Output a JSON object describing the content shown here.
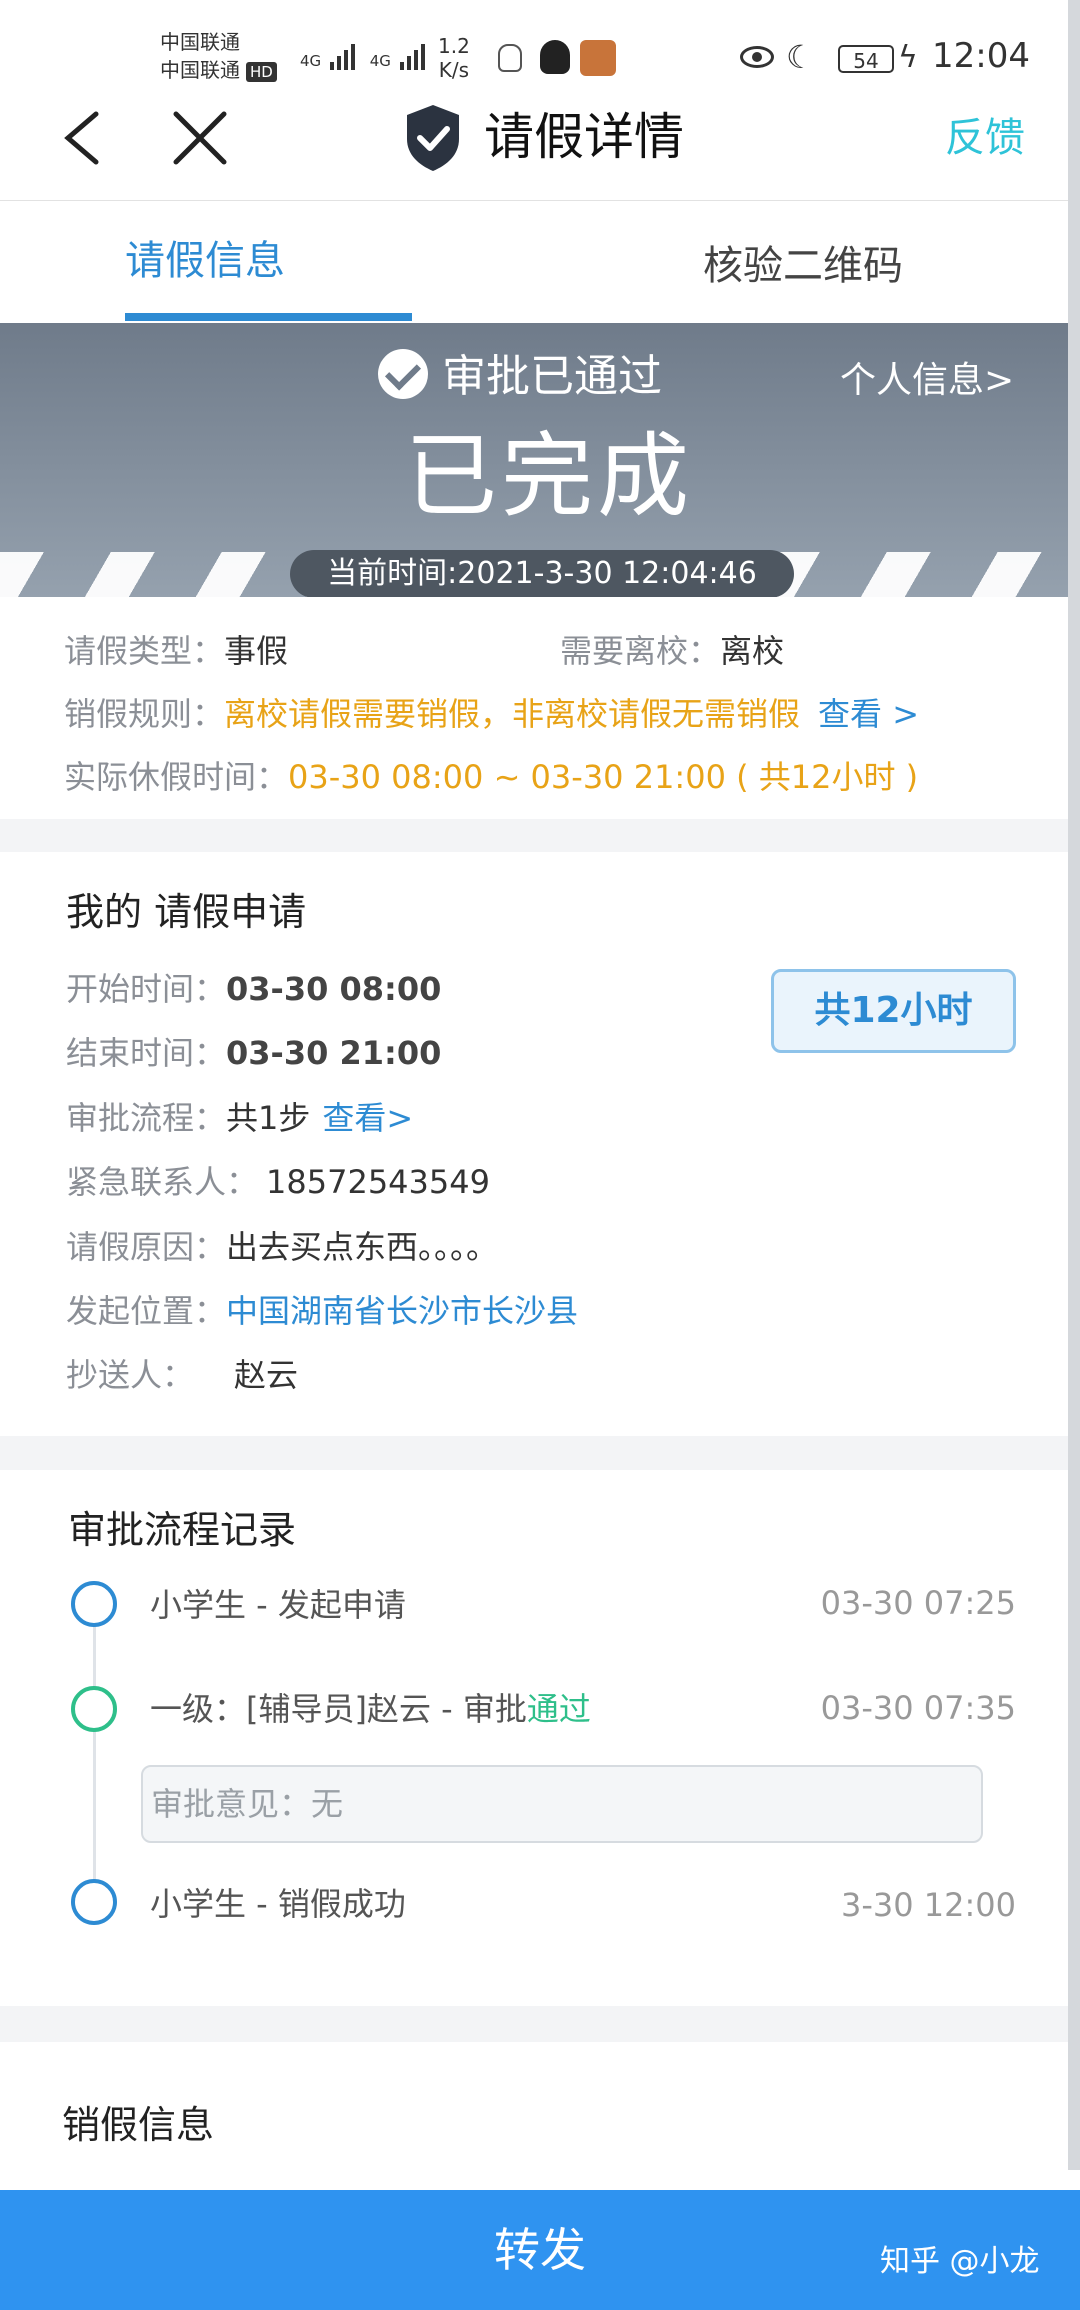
{
  "status_bar": {
    "carrier1": "中国联通",
    "carrier2": "中国联通",
    "hd": "HD",
    "net1": "4G",
    "net2": "4G",
    "speed_value": "1.2",
    "speed_unit": "K/s",
    "battery": "54",
    "time": "12:04"
  },
  "nav": {
    "title": "请假详情",
    "feedback": "反馈"
  },
  "tabs": [
    {
      "label": "请假信息",
      "active": true
    },
    {
      "label": "核验二维码",
      "active": false
    }
  ],
  "banner": {
    "approval_status": "审批已通过",
    "personal_info": "个人信息>",
    "state": "已完成",
    "current_time": "当前时间:2021-3-30 12:04:46"
  },
  "summary": {
    "leave_type_label": "请假类型：",
    "leave_type": "事假",
    "leave_school_label": "需要离校：",
    "leave_school": "离校",
    "rule_label": "销假规则：",
    "rule": "离校请假需要销假，非离校请假无需销假",
    "rule_link": "查看 >",
    "actual_label": "实际休假时间：",
    "actual": "03-30 08:00 ~ 03-30 21:00 ( 共12小时 )"
  },
  "application": {
    "title": "我的 请假申请",
    "start_label": "开始时间：",
    "start": "03-30 08:00",
    "end_label": "结束时间：",
    "end": "03-30 21:00",
    "total": "共12小时",
    "flow_label": "审批流程：",
    "flow": "共1步",
    "flow_link": "查看>",
    "contact_label": "紧急联系人：",
    "contact": "18572543549",
    "reason_label": "请假原因：",
    "reason": "出去买点东西。。。。",
    "location_label": "发起位置：",
    "location": "中国湖南省长沙市长沙县",
    "cc_label": "抄送人：",
    "cc": "赵云"
  },
  "process": {
    "title": "审批流程记录",
    "records": [
      {
        "text": "小学生 - 发起申请",
        "time": "03-30 07:25"
      },
      {
        "text": "一级：[辅导员]赵云 - 审批",
        "result": "通过",
        "time": "03-30 07:35"
      },
      {
        "text": "小学生 - 销假成功",
        "time": "3-30 12:00"
      }
    ],
    "comment": "审批意见：无"
  },
  "cancel": {
    "title": "销假信息"
  },
  "footer": {
    "forward": "转发",
    "watermark": "知乎 @小龙"
  },
  "colors": {
    "accent": "#2d8bd3",
    "teal": "#2ec3d8",
    "orange": "#e8a317",
    "green": "#2ebf8a",
    "button": "#2f93f0"
  }
}
